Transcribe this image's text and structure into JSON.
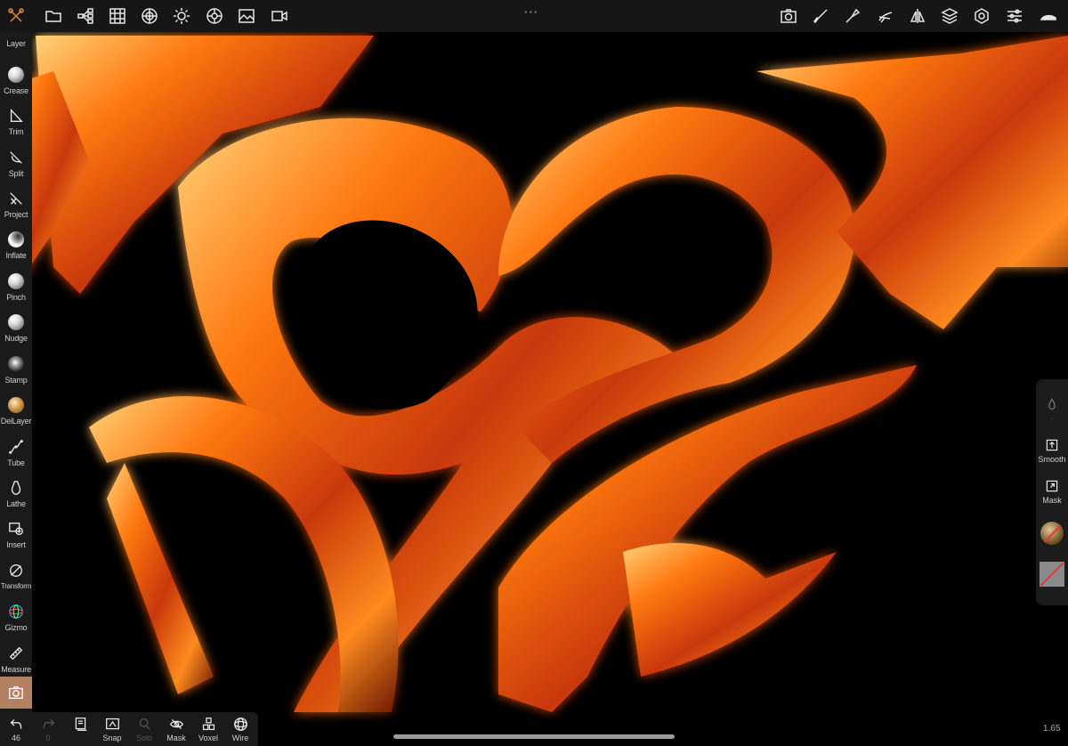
{
  "topbar": {
    "left_icons": [
      "tools-icon",
      "folder-icon",
      "scene-tree-icon",
      "grid-icon",
      "topology-icon",
      "light-icon",
      "material-icon",
      "image-icon",
      "video-icon"
    ],
    "right_icons": [
      "camera-icon",
      "brush-icon",
      "stroke-icon",
      "painting-icon",
      "symmetry-icon",
      "layers-icon",
      "settings-icon",
      "sliders-icon",
      "interface-icon"
    ]
  },
  "sidebar": {
    "items": [
      {
        "label": "Layer",
        "icon": "layer-icon"
      },
      {
        "label": "Crease",
        "icon": "crease-icon"
      },
      {
        "label": "Trim",
        "icon": "trim-icon"
      },
      {
        "label": "Split",
        "icon": "split-icon"
      },
      {
        "label": "Project",
        "icon": "project-icon"
      },
      {
        "label": "Inflate",
        "icon": "inflate-icon"
      },
      {
        "label": "Pinch",
        "icon": "pinch-icon"
      },
      {
        "label": "Nudge",
        "icon": "nudge-icon"
      },
      {
        "label": "Stamp",
        "icon": "stamp-icon"
      },
      {
        "label": "DelLayer",
        "icon": "dellayer-icon"
      },
      {
        "label": "Tube",
        "icon": "tube-icon"
      },
      {
        "label": "Lathe",
        "icon": "lathe-icon"
      },
      {
        "label": "Insert",
        "icon": "insert-icon"
      },
      {
        "label": "Transform",
        "icon": "transform-icon"
      },
      {
        "label": "Gizmo",
        "icon": "gizmo-icon"
      },
      {
        "label": "Measure",
        "icon": "measure-icon"
      }
    ],
    "active_color": "#b48062"
  },
  "bottombar": {
    "undo_count": "46",
    "redo_count": "0",
    "items": [
      {
        "label": "Snap"
      },
      {
        "label": "Solo"
      },
      {
        "label": "Mask"
      },
      {
        "label": "Voxel"
      },
      {
        "label": "Wire"
      }
    ]
  },
  "rightpanel": {
    "dot": "·",
    "items": [
      {
        "label": "Smooth",
        "icon": "smooth-icon"
      },
      {
        "label": "Mask",
        "icon": "mask-icon"
      }
    ]
  },
  "status": {
    "version": "1.65"
  },
  "colors": {
    "accent": "#b48062",
    "model_orange": "#ff6a10",
    "background": "#000000"
  }
}
